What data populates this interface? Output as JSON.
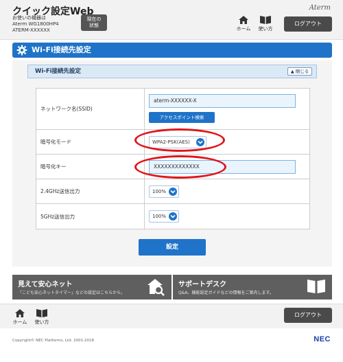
{
  "header": {
    "app_title": "クイック設定Web",
    "device_line1": "お使いの機器は",
    "device_line2": "Aterm WG1800HP4",
    "device_line3": "ATERM-XXXXXX",
    "current_status_line1": "現在の",
    "current_status_line2": "状態",
    "brand": "Aterm",
    "home_label": "ホーム",
    "howto_label": "使い方",
    "logout_label": "ログアウト"
  },
  "title_bar": {
    "title": "Wi-Fi接続先設定"
  },
  "section": {
    "title": "Wi-Fi接続先設定",
    "close_label": "閉じる"
  },
  "form": {
    "ssid_label": "ネットワーク名(SSID)",
    "ssid_value": "aterm-XXXXXX-X",
    "ap_search_label": "アクセスポイント検索",
    "enc_mode_label": "暗号化モード",
    "enc_mode_value": "WPA2-PSK(AES)",
    "enc_key_label": "暗号化キー",
    "enc_key_value": "XXXXXXXXXXXXX",
    "tx24_label": "2.4GHz送信出力",
    "tx24_value": "100%",
    "tx5_label": "5GHz送信出力",
    "tx5_value": "100%"
  },
  "submit_label": "設定",
  "banners": {
    "left_title": "見えて安心ネット",
    "left_desc": "「こども安心ネットタイマー」などの設定はこちらから。",
    "right_title": "サポートデスク",
    "right_desc": "Q&A、機能設定ガイドなどの情報をご案内します。"
  },
  "footer": {
    "home_label": "ホーム",
    "howto_label": "使い方",
    "logout_label": "ログアウト",
    "copyright": "Copyright© NEC Platforms, Ltd. 2001-2018",
    "nec_logo": "NEC"
  },
  "colors": {
    "accent": "#1f73c8",
    "highlight_oval": "#e0161a",
    "banner": "#5f5f5f"
  }
}
